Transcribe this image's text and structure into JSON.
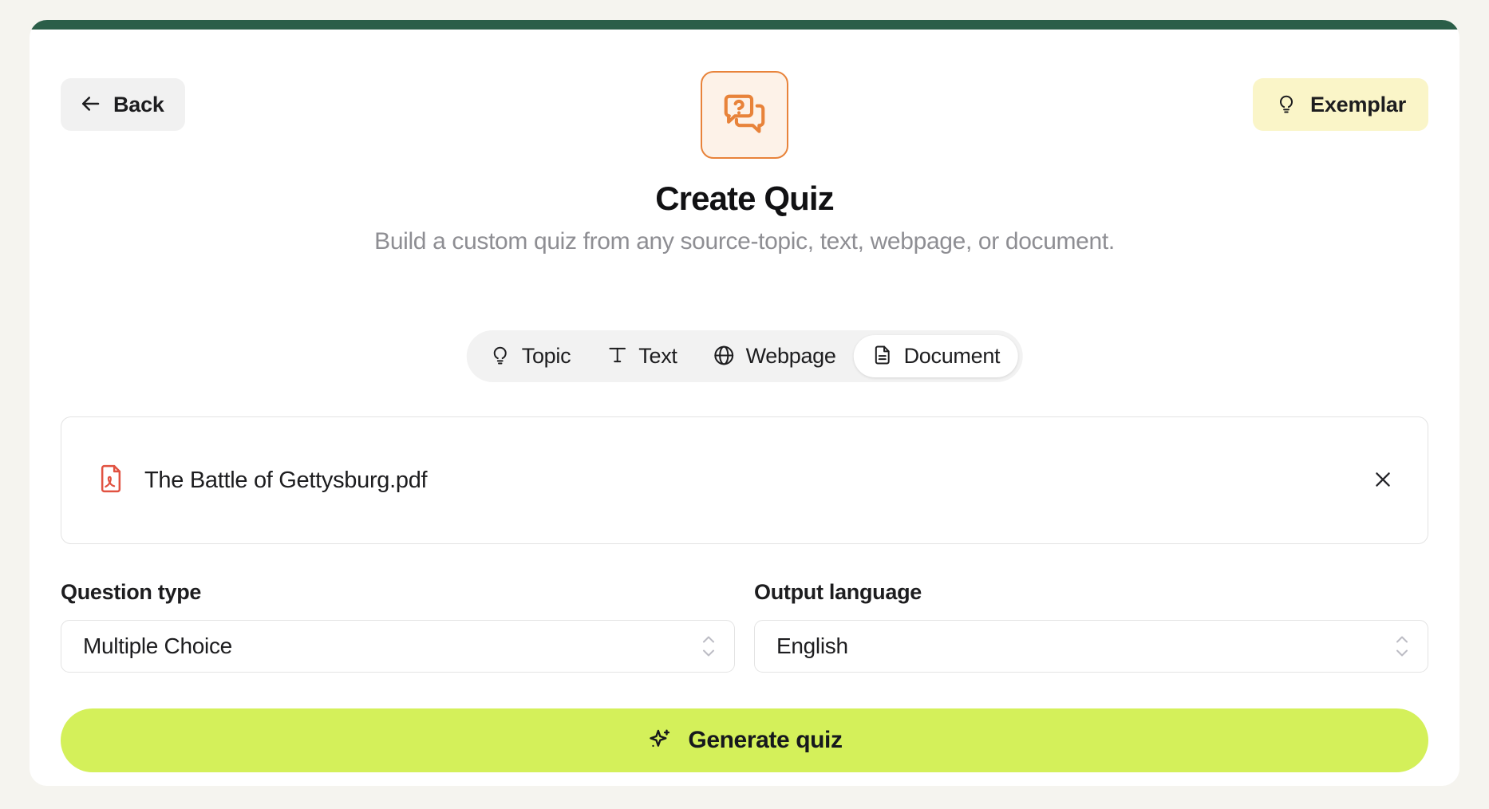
{
  "theme": {
    "page_background": "#f5f4ef",
    "card_background": "#ffffff",
    "topbar_green": "#2b5e48",
    "accent_orange": "#e8833a",
    "accent_orange_tint": "#fdf2e8",
    "exemplar_yellow": "#faf5c8",
    "generate_lime": "#d4f05a",
    "pdf_red": "#e15241",
    "muted_text": "#8e8e93"
  },
  "header": {
    "back_label": "Back",
    "back_icon": "arrow-left-icon",
    "exemplar_label": "Exemplar",
    "exemplar_icon": "lightbulb-icon",
    "hero_icon": "chat-question-icon"
  },
  "hero": {
    "title": "Create Quiz",
    "subtitle": "Build a custom quiz from any source-topic, text, webpage, or document."
  },
  "source_tabs": {
    "selected": "Document",
    "items": [
      {
        "label": "Topic",
        "icon": "lightbulb-icon",
        "active": false
      },
      {
        "label": "Text",
        "icon": "text-t-icon",
        "active": false
      },
      {
        "label": "Webpage",
        "icon": "globe-icon",
        "active": false
      },
      {
        "label": "Document",
        "icon": "document-icon",
        "active": true
      }
    ]
  },
  "file_upload": {
    "file_name": "The Battle of Gettysburg.pdf",
    "file_icon": "pdf-file-icon",
    "remove_icon": "close-icon"
  },
  "fields": [
    {
      "label": "Question type",
      "value": "Multiple Choice",
      "stepper_icon": "chevron-up-down-icon"
    },
    {
      "label": "Output language",
      "value": "English",
      "stepper_icon": "chevron-up-down-icon"
    }
  ],
  "generate": {
    "label": "Generate quiz",
    "icon": "sparkles-icon"
  }
}
